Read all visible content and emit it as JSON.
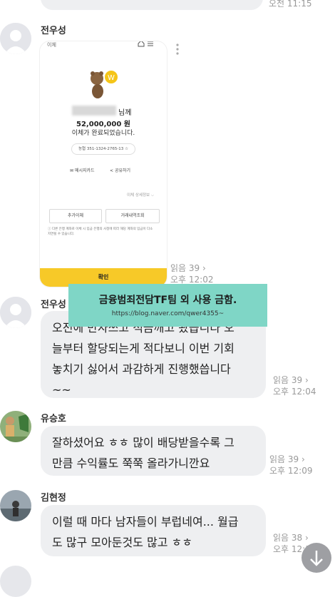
{
  "top_bubble": {
    "time": "오전 11:15"
  },
  "messages": [
    {
      "sender": "전우성",
      "card": {
        "header_title": "이체",
        "recipient_suffix": "님께",
        "amount": "52,000,000 원",
        "status": "이체가 완료되었습니다.",
        "account": "농협 351-1324-2765-13",
        "memo_card": "메시지카드",
        "share": "공유하기",
        "detail_link": "이체 상세정보",
        "add_transfer": "추가이체",
        "history": "거래내역조회",
        "notice": "다른 은행 계좌로 이체 시 입금 은행의 사정에 따라 해당 계좌의 입금이 다소 지연될 수 있습니다.",
        "confirm": "확인"
      },
      "read": "읽음 39",
      "time": "오후 12:02"
    },
    {
      "sender": "전우성",
      "text_lines": [
        "오전에 만자쓰고 적금깨고 왔습니다 오",
        "늘부터 할당되는게 적다보니 이번 기회",
        "놓치기 싫어서 과감하게 진행했씁니다",
        "~~"
      ],
      "read": "읽음 39",
      "time": "오후 12:04"
    },
    {
      "sender": "유승호",
      "text_lines": [
        "잘하셨어요 ㅎㅎ 많이 배당받을수록 그",
        "만큼 수익률도 쭉쭉 올라가니깐요"
      ],
      "read": "읽음 39",
      "time": "오후 12:09"
    },
    {
      "sender": "김현정",
      "text_lines": [
        "이럴 때 마다 남자들이 부럽네여... 월급",
        "도 많구 모아둔것도 많고 ㅎㅎ"
      ],
      "read": "읽음 38",
      "time": "오후 12:1"
    }
  ],
  "watermark": {
    "title": "금융범죄전담TF팀 외 사용 금함.",
    "url": "https://blog.naver.com/qwer4355~"
  },
  "colors": {
    "bubble": "#eeeff1",
    "confirm": "#f7c928",
    "watermark": "#7fd6c6"
  }
}
